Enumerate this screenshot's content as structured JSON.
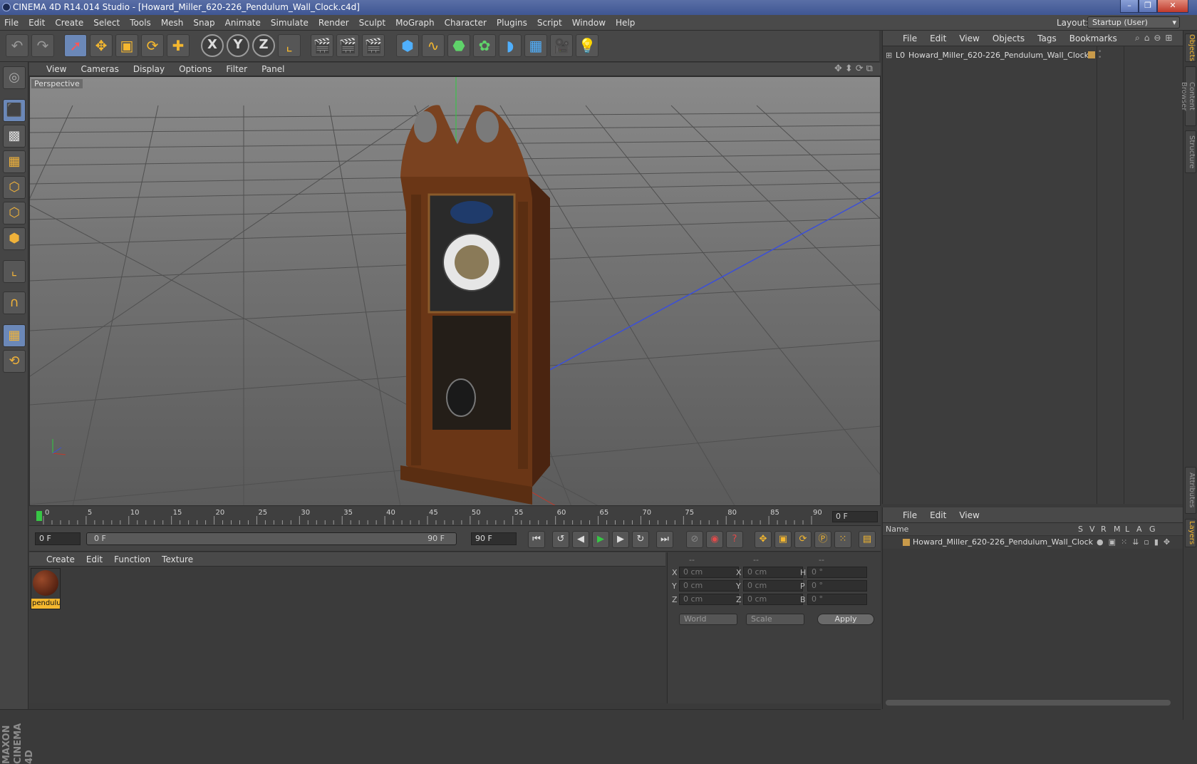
{
  "window": {
    "title": "CINEMA 4D R14.014 Studio - [Howard_Miller_620-226_Pendulum_Wall_Clock.c4d]",
    "controls": [
      "–",
      "❐",
      "✕"
    ]
  },
  "menubar": {
    "items": [
      "File",
      "Edit",
      "Create",
      "Select",
      "Tools",
      "Mesh",
      "Snap",
      "Animate",
      "Simulate",
      "Render",
      "Sculpt",
      "MoGraph",
      "Character",
      "Plugins",
      "Script",
      "Window",
      "Help"
    ],
    "layout_label": "Layout:",
    "layout_value": "Startup (User)"
  },
  "viewport": {
    "menu": [
      "View",
      "Cameras",
      "Display",
      "Options",
      "Filter",
      "Panel"
    ],
    "label": "Perspective"
  },
  "timeline": {
    "ticks": [
      "0",
      "5",
      "10",
      "15",
      "20",
      "25",
      "30",
      "35",
      "40",
      "45",
      "50",
      "55",
      "60",
      "65",
      "70",
      "75",
      "80",
      "85",
      "90"
    ],
    "current_frame": "0 F"
  },
  "transport": {
    "start_field": "0 F",
    "range_start": "0 F",
    "range_end": "90 F",
    "end_field": "90 F"
  },
  "material_manager": {
    "menu": [
      "Create",
      "Edit",
      "Function",
      "Texture"
    ],
    "material_name": "pendulu"
  },
  "coordinates": {
    "header": [
      "--",
      "--",
      "--"
    ],
    "rows": [
      {
        "a": "X",
        "av": "0 cm",
        "b": "X",
        "bv": "0 cm",
        "c": "H",
        "cv": "0 °"
      },
      {
        "a": "Y",
        "av": "0 cm",
        "b": "Y",
        "bv": "0 cm",
        "c": "P",
        "cv": "0 °"
      },
      {
        "a": "Z",
        "av": "0 cm",
        "b": "Z",
        "bv": "0 cm",
        "c": "B",
        "cv": "0 °"
      }
    ],
    "space": "World",
    "mode": "Scale",
    "apply": "Apply"
  },
  "object_manager": {
    "menu": [
      "File",
      "Edit",
      "View",
      "Objects",
      "Tags",
      "Bookmarks"
    ],
    "object_name": "Howard_Miller_620-226_Pendulum_Wall_Clock",
    "object_prefix": "L0"
  },
  "layer_manager": {
    "menu": [
      "File",
      "Edit",
      "View"
    ],
    "columns": [
      "Name",
      "S",
      "V",
      "R",
      "M",
      "L",
      "A",
      "G"
    ],
    "layer_name": "Howard_Miller_620-226_Pendulum_Wall_Clock"
  },
  "side_tabs": [
    "Objects",
    "Content Browser",
    "Structure",
    "Attributes",
    "Layers"
  ],
  "brand": "MAXON CINEMA 4D",
  "colors": {
    "accent": "#f4b72f",
    "selected": "#6b88b8",
    "axis_x": "#c0392b",
    "axis_y": "#2ecc40",
    "axis_z": "#3b4fd9"
  }
}
